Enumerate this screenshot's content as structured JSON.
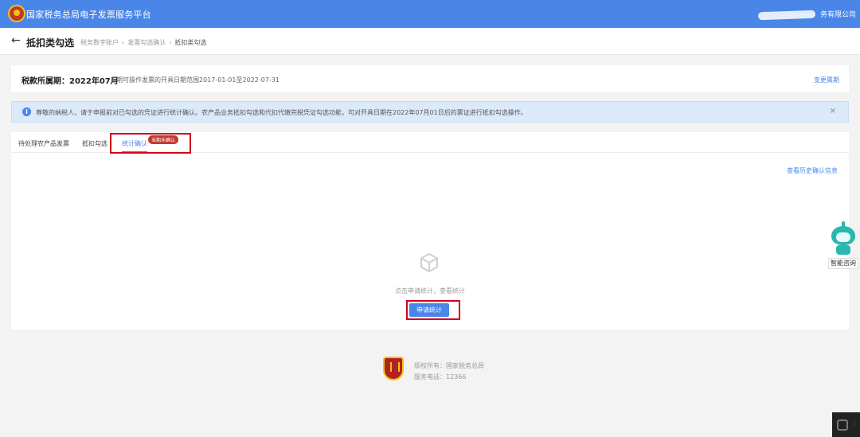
{
  "header": {
    "platform_title": "国家税务总局电子发票服务平台",
    "company_suffix": "务有限公司"
  },
  "subheader": {
    "page_title": "抵扣类勾选",
    "breadcrumb": [
      "税务数字账户",
      "发票勾选确认",
      "抵扣类勾选"
    ]
  },
  "period": {
    "label": "税款所属期：2022年07月",
    "note": "当期可操作发票的开具日期范围2017-01-01至2022-07-31",
    "change_link": "变更属期"
  },
  "notice": {
    "text": "尊敬的纳税人，请于申报前对已勾选的凭证进行统计确认。农产品业务抵扣勾选和代扣代缴完税凭证勾选功能，可对开具日期在2022年07月01日后的票证进行抵扣勾选操作。",
    "close": "×"
  },
  "tabs": [
    {
      "label": "待处理农产品发票"
    },
    {
      "label": "抵扣勾选"
    },
    {
      "label": "统计确认",
      "badge": "当期未确认"
    }
  ],
  "main": {
    "history_link": "查看历史确认信息",
    "empty_text": "点击申请统计，查看统计",
    "apply_button": "申请统计"
  },
  "footer": {
    "copyright": "版权所有：国家税务总局",
    "phone": "服务电话：12366"
  },
  "assistant": {
    "label": "智能咨询"
  },
  "colors": {
    "primary": "#4a86e8",
    "highlight": "#d0021b",
    "badge": "#c0392b"
  }
}
